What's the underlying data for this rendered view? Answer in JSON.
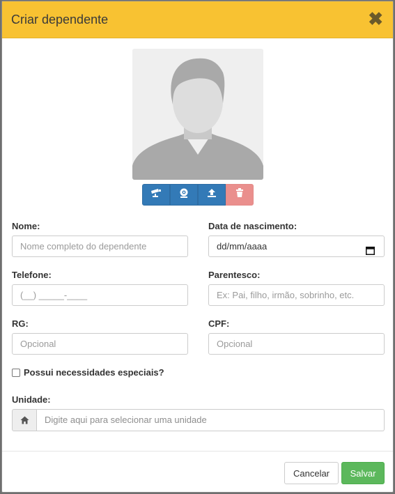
{
  "modal": {
    "title": "Criar dependente",
    "close_glyph": "✖"
  },
  "photo": {
    "placeholder_icon": "person-silhouette-icon",
    "toolbar": [
      {
        "icon": "camera-icon"
      },
      {
        "icon": "webcam-icon"
      },
      {
        "icon": "upload-icon"
      },
      {
        "icon": "trash-icon"
      }
    ]
  },
  "form": {
    "nome": {
      "label": "Nome:",
      "placeholder": "Nome completo do dependente"
    },
    "data_nascimento": {
      "label": "Data de nascimento:",
      "value": "dd/mm/aaaa"
    },
    "telefone": {
      "label": "Telefone:",
      "placeholder": "(__) _____-____"
    },
    "parentesco": {
      "label": "Parentesco:",
      "placeholder": "Ex: Pai, filho, irmão, sobrinho, etc."
    },
    "rg": {
      "label": "RG:",
      "placeholder": "Opcional"
    },
    "cpf": {
      "label": "CPF:",
      "placeholder": "Opcional"
    },
    "necessidades": {
      "label": "Possui necessidades especiais?",
      "checked": false
    },
    "unidade": {
      "label": "Unidade:",
      "placeholder": "Digite aqui para selecionar uma unidade",
      "addon_icon": "home-icon"
    }
  },
  "footer": {
    "cancel_label": "Cancelar",
    "save_label": "Salvar"
  },
  "colors": {
    "header": "#f8c232",
    "primary": "#337ab7",
    "danger": "#ea8f8d",
    "success": "#5cb85c"
  }
}
